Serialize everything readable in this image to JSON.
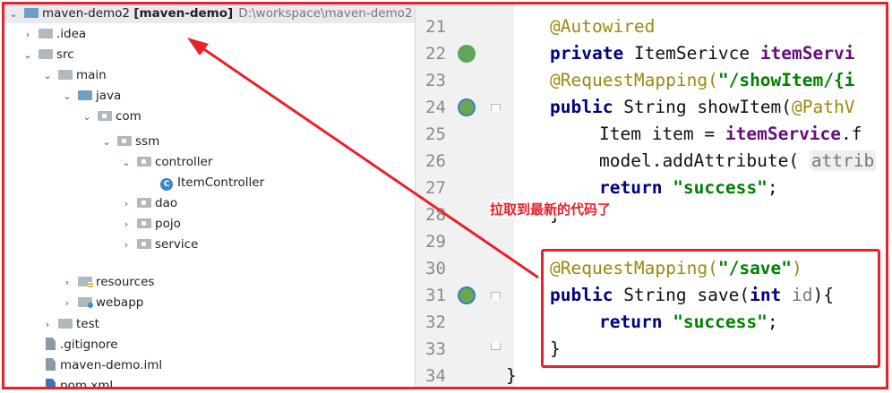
{
  "tree": {
    "root": {
      "name": "maven-demo2",
      "module": "[maven-demo]",
      "path": "D:\\workspace\\maven-demo2"
    },
    "items": [
      {
        "label": ".idea"
      },
      {
        "label": "src"
      },
      {
        "label": "main"
      },
      {
        "label": "java"
      },
      {
        "label": "com"
      },
      {
        "label": "ssm"
      },
      {
        "label": "controller"
      },
      {
        "label": "ItemController"
      },
      {
        "label": "dao"
      },
      {
        "label": "pojo"
      },
      {
        "label": "service"
      },
      {
        "label": "resources"
      },
      {
        "label": "webapp"
      },
      {
        "label": "test"
      },
      {
        "label": ".gitignore"
      },
      {
        "label": "maven-demo.iml"
      },
      {
        "label": "pom.xml"
      }
    ],
    "class_badge": "C"
  },
  "editor": {
    "line_numbers": [
      "21",
      "22",
      "23",
      "24",
      "25",
      "26",
      "27",
      "28",
      "29",
      "30",
      "31",
      "32",
      "33",
      "34"
    ],
    "code": {
      "l21_ann": "@Autowired",
      "l22_kw": "private",
      "l22_type": " ItemSerivce ",
      "l22_field": "itemServi",
      "l23_ann": "@RequestMapping(",
      "l23_str": "\"/showItem/{i",
      "l24_kw": "public",
      "l24_rest": " String showItem(",
      "l24_ann": "@PathV",
      "l25_type": "Item item = ",
      "l25_field": "itemService",
      "l25_rest": ".f",
      "l26_rest": "model.addAttribute( ",
      "l26_hint": "attrib",
      "l27_kw": "return",
      "l27_str": " \"success\"",
      "l27_end": ";",
      "l28_brace": "}",
      "l30_ann": "@RequestMapping(",
      "l30_str": "\"/save\"",
      "l30_end": ")",
      "l31_kw": "public",
      "l31_rest": " String save(",
      "l31_kw2": "int",
      "l31_param": " id",
      "l31_end": "){",
      "l32_kw": "return",
      "l32_str": " \"success\"",
      "l32_end": ";",
      "l33_brace": "}",
      "l34_brace": "}"
    }
  },
  "annotation": {
    "label": "拉取到最新的代码了",
    "color": "#e8212b"
  }
}
